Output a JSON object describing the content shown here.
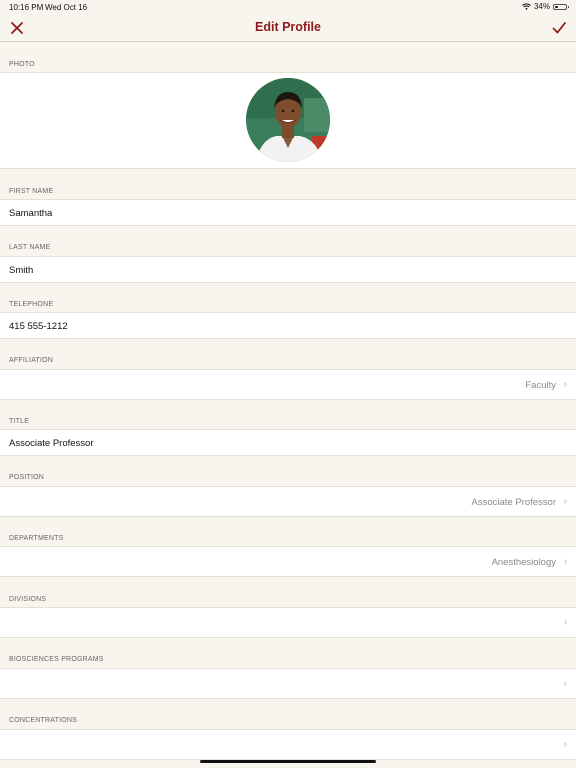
{
  "status_bar": {
    "time": "10:16 PM",
    "date": "Wed Oct 16",
    "battery_percent": "34%",
    "battery_level": 0.34
  },
  "nav": {
    "title": "Edit Profile",
    "close_icon": "close-icon",
    "done_icon": "checkmark-icon",
    "accent_color": "#8e1a1d"
  },
  "photo": {
    "header": "PHOTO"
  },
  "fields": {
    "first_name": {
      "header": "FIRST NAME",
      "value": "Samantha"
    },
    "last_name": {
      "header": "LAST NAME",
      "value": "Smith"
    },
    "telephone": {
      "header": "TELEPHONE",
      "value": "415 555-1212"
    },
    "affiliation": {
      "header": "AFFILIATION",
      "value": "Faculty"
    },
    "title": {
      "header": "TITLE",
      "value": "Associate Professor"
    },
    "position": {
      "header": "POSITION",
      "value": "Associate Professor"
    },
    "departments": {
      "header": "DEPARTMENTS",
      "value": "Anesthesiology"
    },
    "divisions": {
      "header": "DIVISIONS",
      "value": ""
    },
    "biosciences_programs": {
      "header": "BIOSCIENCES PROGRAMS",
      "value": ""
    },
    "concentrations": {
      "header": "CONCENTRATIONS",
      "value": ""
    }
  },
  "chevron_glyph": "›"
}
